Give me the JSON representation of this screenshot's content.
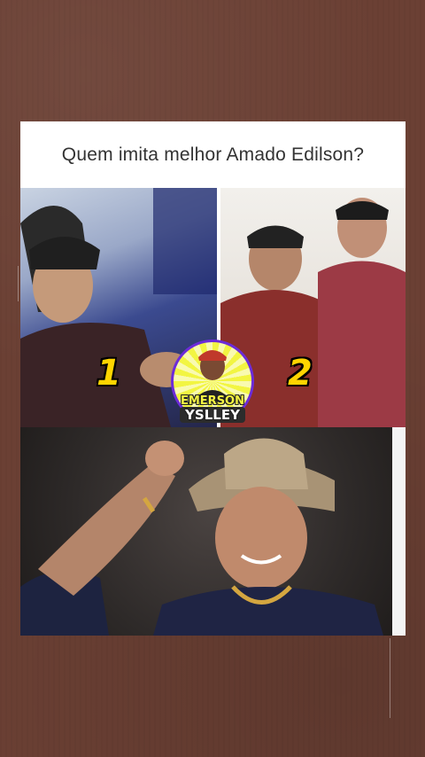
{
  "question": "Quem imita melhor Amado Edilson?",
  "labels": {
    "option1": "1",
    "option2": "2"
  },
  "badge": {
    "line1": "EMERSON",
    "line2": "YSLLEY"
  },
  "colors": {
    "background": "#6b4034",
    "number": "#ffd400",
    "badge_ring": "#6c2bd9"
  }
}
